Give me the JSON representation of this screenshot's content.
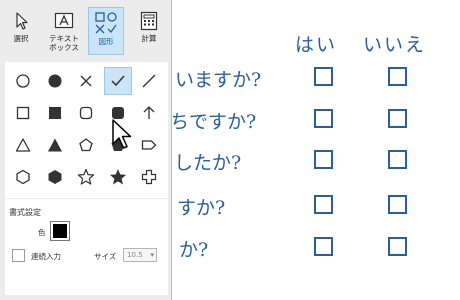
{
  "toolbar": {
    "tools": [
      {
        "id": "select",
        "label": "選択",
        "icon": "arrow-cursor-icon",
        "active": false
      },
      {
        "id": "textbox",
        "label": "テキスト\nボックス",
        "icon": "textbox-icon",
        "active": false
      },
      {
        "id": "shapes",
        "label": "図形",
        "icon": "shapes-icon",
        "active": true
      },
      {
        "id": "calc",
        "label": "計算",
        "icon": "calculator-icon",
        "active": false
      }
    ]
  },
  "shapes": {
    "selected": "check",
    "items": [
      "circle-outline",
      "circle-filled",
      "cross",
      "check",
      "line",
      "square-outline",
      "square-filled",
      "rounded-square-outline",
      "rounded-square-filled",
      "arrow-up",
      "triangle-outline",
      "triangle-filled",
      "pentagon-outline",
      "pentagon-filled",
      "tag-outline",
      "hexagon-outline",
      "hexagon-filled",
      "star-outline",
      "star-filled",
      "plus-outline"
    ]
  },
  "format": {
    "title": "書式設定",
    "color_label": "色",
    "color_value": "#000000",
    "continuous_label": "連続入力",
    "continuous_checked": false,
    "size_label": "サイズ",
    "size_value": "10.5"
  },
  "document": {
    "headers": {
      "yes": "はい",
      "no": "いいえ"
    },
    "text_color": "#2b5f9a",
    "questions": [
      "いますか?",
      "ちですか?",
      "したか?",
      "すか?",
      "か?"
    ]
  }
}
